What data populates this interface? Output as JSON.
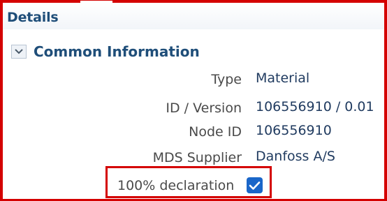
{
  "panel": {
    "title": "Details",
    "section": {
      "title": "Common Information",
      "expanded": true
    },
    "fields": [
      {
        "label": "Type",
        "value": "Material"
      },
      {
        "label": "ID / Version",
        "value": "106556910 / 0.01"
      },
      {
        "label": "Node ID",
        "value": "106556910"
      },
      {
        "label": "MDS Supplier",
        "value": "Danfoss A/S"
      }
    ],
    "declaration": {
      "label": "100% declaration",
      "checked": true
    }
  },
  "colors": {
    "highlight": "#d40000",
    "title": "#1f4e79",
    "checkbox": "#1a66c9"
  },
  "icons": {
    "toggle": "chevron-down-icon",
    "check": "checkmark-icon"
  }
}
